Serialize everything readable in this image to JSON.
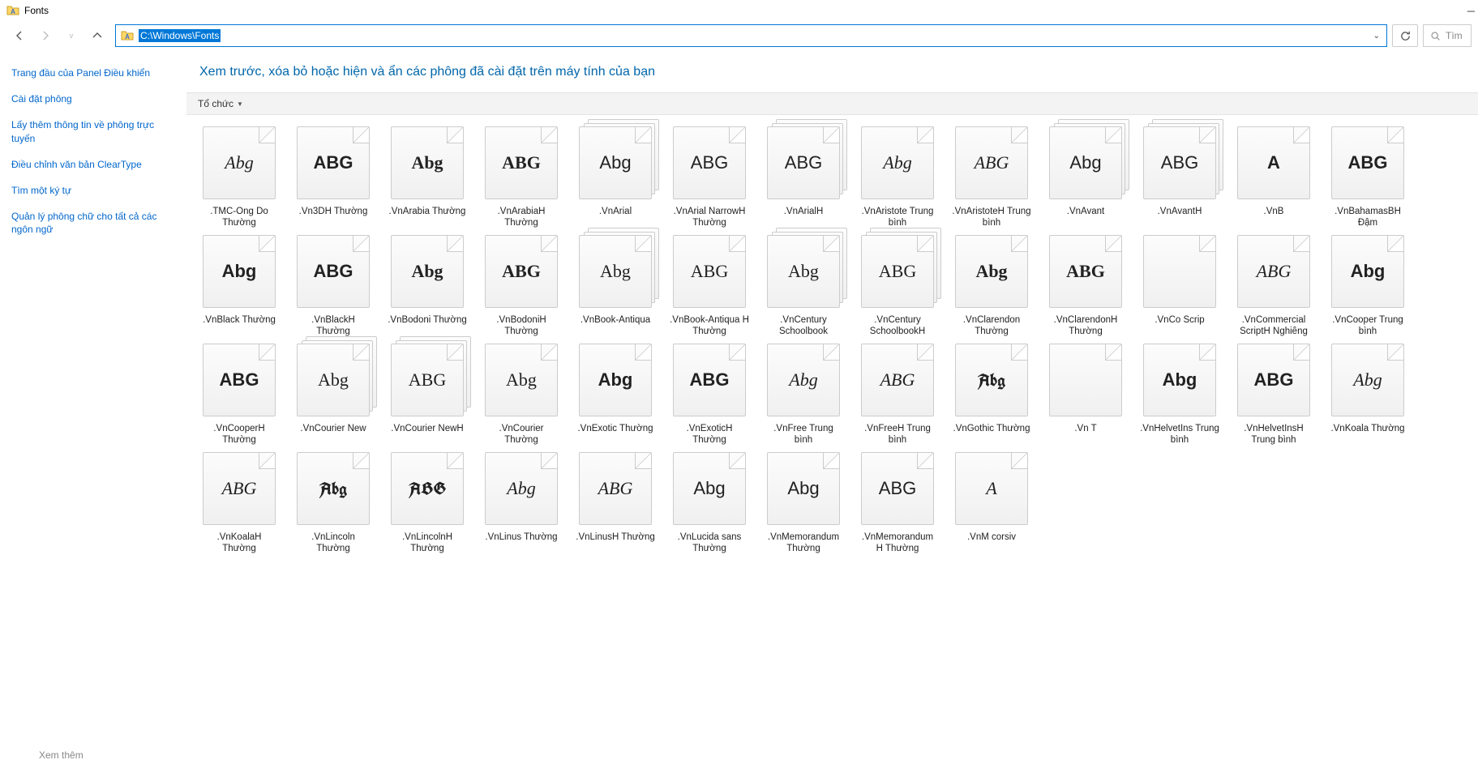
{
  "window": {
    "title": "Fonts"
  },
  "nav": {
    "path": "C:\\Windows\\Fonts",
    "search_placeholder": "Tìm"
  },
  "sidebar": {
    "items": [
      "Trang đầu của Panel Điều khiển",
      "Cài đặt phông",
      "Lấy thêm thông tin về phông trực tuyến",
      "Điều chỉnh văn bản ClearType",
      "Tìm một ký tự",
      "Quản lý phông chữ cho tất cả các ngôn ngữ"
    ],
    "footer": "Xem thêm"
  },
  "content": {
    "header": "Xem trước, xóa bỏ hoặc hiện và ẩn các phông đã cài đặt trên máy tính của bạn",
    "toolbar": {
      "organize": "Tổ chức"
    }
  },
  "fonts": [
    {
      "label": ".TMC-Ong Do Thường",
      "preview": "Abg",
      "cls": "script",
      "stack": false
    },
    {
      "label": ".Vn3DH Thường",
      "preview": "ABG",
      "cls": "bold caps",
      "stack": false
    },
    {
      "label": ".VnArabia Thường",
      "preview": "Abg",
      "cls": "serif bold",
      "stack": false
    },
    {
      "label": ".VnArabiaH Thường",
      "preview": "ABG",
      "cls": "serif bold caps",
      "stack": false
    },
    {
      "label": ".VnArial",
      "preview": "Abg",
      "cls": "",
      "stack": true
    },
    {
      "label": ".VnArial NarrowH Thường",
      "preview": "ABG",
      "cls": "caps",
      "stack": false
    },
    {
      "label": ".VnArialH",
      "preview": "ABG",
      "cls": "caps",
      "stack": true
    },
    {
      "label": ".VnAristote Trung bình",
      "preview": "Abg",
      "cls": "script italic",
      "stack": false
    },
    {
      "label": ".VnAristoteH Trung bình",
      "preview": "ABG",
      "cls": "script italic caps",
      "stack": false
    },
    {
      "label": ".VnAvant",
      "preview": "Abg",
      "cls": "",
      "stack": true
    },
    {
      "label": ".VnAvantH",
      "preview": "ABG",
      "cls": "caps",
      "stack": true
    },
    {
      "label": ".VnB",
      "preview": "A",
      "cls": "bold",
      "stack": false
    },
    {
      "label": ".VnBahamasBH Đậm",
      "preview": "ABG",
      "cls": "bold caps",
      "stack": false
    },
    {
      "label": ".VnBlack Thường",
      "preview": "Abg",
      "cls": "black",
      "stack": false
    },
    {
      "label": ".VnBlackH Thường",
      "preview": "ABG",
      "cls": "black caps",
      "stack": false
    },
    {
      "label": ".VnBodoni Thường",
      "preview": "Abg",
      "cls": "serif bold",
      "stack": false
    },
    {
      "label": ".VnBodoniH Thường",
      "preview": "ABG",
      "cls": "serif bold caps",
      "stack": false
    },
    {
      "label": ".VnBook-Antiqua",
      "preview": "Abg",
      "cls": "serif",
      "stack": true
    },
    {
      "label": ".VnBook-Antiqua H Thường",
      "preview": "ABG",
      "cls": "serif caps",
      "stack": false
    },
    {
      "label": ".VnCentury Schoolbook",
      "preview": "Abg",
      "cls": "serif",
      "stack": true
    },
    {
      "label": ".VnCentury SchoolbookH",
      "preview": "ABG",
      "cls": "serif caps",
      "stack": true
    },
    {
      "label": ".VnClarendon Thường",
      "preview": "Abg",
      "cls": "serif bold",
      "stack": false
    },
    {
      "label": ".VnClarendonH Thường",
      "preview": "ABG",
      "cls": "serif bold caps",
      "stack": false
    },
    {
      "label": ".VnCo Scrip",
      "preview": "",
      "cls": "",
      "stack": false
    },
    {
      "label": ".VnCommercial ScriptH Nghiêng",
      "preview": "ABG",
      "cls": "script italic caps",
      "stack": false
    },
    {
      "label": ".VnCooper Trung bình",
      "preview": "Abg",
      "cls": "black",
      "stack": false
    },
    {
      "label": ".VnCooperH Thường",
      "preview": "ABG",
      "cls": "black caps",
      "stack": false
    },
    {
      "label": ".VnCourier New",
      "preview": "Abg",
      "cls": "serif",
      "stack": true
    },
    {
      "label": ".VnCourier NewH",
      "preview": "ABG",
      "cls": "serif caps",
      "stack": true
    },
    {
      "label": ".VnCourier Thường",
      "preview": "Abg",
      "cls": "serif",
      "stack": false
    },
    {
      "label": ".VnExotic Thường",
      "preview": "Abg",
      "cls": "bold",
      "stack": false
    },
    {
      "label": ".VnExoticH Thường",
      "preview": "ABG",
      "cls": "bold caps",
      "stack": false
    },
    {
      "label": ".VnFree Trung bình",
      "preview": "Abg",
      "cls": "script italic",
      "stack": false
    },
    {
      "label": ".VnFreeH Trung bình",
      "preview": "ABG",
      "cls": "script italic caps",
      "stack": false
    },
    {
      "label": ".VnGothic Thường",
      "preview": "Abg",
      "cls": "blackletter",
      "stack": false
    },
    {
      "label": ".Vn T",
      "preview": "",
      "cls": "",
      "stack": false
    },
    {
      "label": ".VnHelvetIns Trung bình",
      "preview": "Abg",
      "cls": "black",
      "stack": false
    },
    {
      "label": ".VnHelvetInsH Trung bình",
      "preview": "ABG",
      "cls": "black caps",
      "stack": false
    },
    {
      "label": ".VnKoala Thường",
      "preview": "Abg",
      "cls": "script italic",
      "stack": false
    },
    {
      "label": ".VnKoalaH Thường",
      "preview": "ABG",
      "cls": "script italic caps",
      "stack": false
    },
    {
      "label": ".VnLincoln Thường",
      "preview": "Abg",
      "cls": "blackletter",
      "stack": false
    },
    {
      "label": ".VnLincolnH Thường",
      "preview": "ABG",
      "cls": "blackletter caps",
      "stack": false
    },
    {
      "label": ".VnLinus Thường",
      "preview": "Abg",
      "cls": "script",
      "stack": false
    },
    {
      "label": ".VnLinusH Thường",
      "preview": "ABG",
      "cls": "script caps",
      "stack": false
    },
    {
      "label": ".VnLucida sans Thường",
      "preview": "Abg",
      "cls": "",
      "stack": false
    },
    {
      "label": ".VnMemorandum Thường",
      "preview": "Abg",
      "cls": "",
      "stack": false
    },
    {
      "label": ".VnMemorandum H Thường",
      "preview": "ABG",
      "cls": "caps",
      "stack": false
    },
    {
      "label": ".VnM corsiv",
      "preview": "A",
      "cls": "script italic",
      "stack": false
    }
  ]
}
